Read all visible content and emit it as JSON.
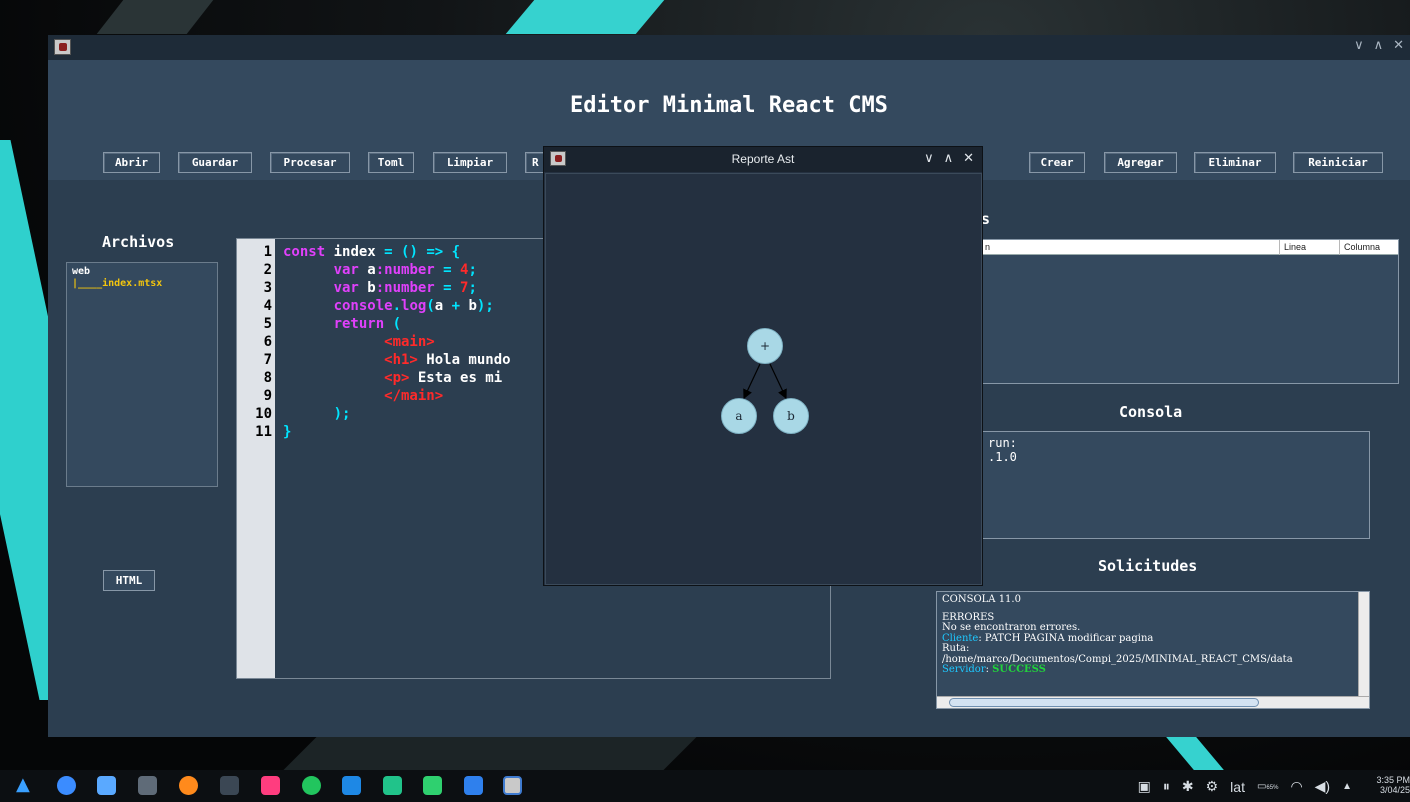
{
  "window": {
    "title": "",
    "controls": [
      "∨",
      "∧",
      "✕"
    ]
  },
  "app": {
    "title": "Editor Minimal React CMS"
  },
  "toolbar": {
    "abrir": "Abrir",
    "guardar": "Guardar",
    "procesar": "Procesar",
    "toml": "Toml",
    "limpiar": "Limpiar",
    "reporte_partial": "R",
    "crear": "Crear",
    "agregar": "Agregar",
    "eliminar": "Eliminar",
    "reiniciar": "Reiniciar"
  },
  "sidebar": {
    "heading": "Archivos",
    "tree_root": "web",
    "tree_file": "|____index.mtsx",
    "html_button": "HTML"
  },
  "editor": {
    "line_numbers": [
      "1",
      "2",
      "3",
      "4",
      "5",
      "6",
      "7",
      "8",
      "9",
      "10",
      "11"
    ],
    "lines": [
      [
        {
          "t": "const",
          "c": "k"
        },
        {
          "t": " index ",
          "c": "w"
        },
        {
          "t": "= () => {",
          "c": "c"
        }
      ],
      [
        {
          "t": "      var ",
          "c": "k"
        },
        {
          "t": "a",
          "c": "w"
        },
        {
          "t": ":number",
          "c": "k"
        },
        {
          "t": " = ",
          "c": "c"
        },
        {
          "t": "4",
          "c": "r"
        },
        {
          "t": ";",
          "c": "c"
        }
      ],
      [
        {
          "t": "      var ",
          "c": "k"
        },
        {
          "t": "b",
          "c": "w"
        },
        {
          "t": ":number",
          "c": "k"
        },
        {
          "t": " = ",
          "c": "c"
        },
        {
          "t": "7",
          "c": "r"
        },
        {
          "t": ";",
          "c": "c"
        }
      ],
      [
        {
          "t": "      console",
          "c": "k"
        },
        {
          "t": ".",
          "c": "c"
        },
        {
          "t": "log",
          "c": "k"
        },
        {
          "t": "(",
          "c": "c"
        },
        {
          "t": "a",
          "c": "w"
        },
        {
          "t": " + ",
          "c": "c"
        },
        {
          "t": "b",
          "c": "w"
        },
        {
          "t": ");",
          "c": "c"
        }
      ],
      [
        {
          "t": "      return ",
          "c": "k"
        },
        {
          "t": "(",
          "c": "c"
        }
      ],
      [
        {
          "t": "            <main>",
          "c": "r"
        }
      ],
      [
        {
          "t": "            <h1>",
          "c": "r"
        },
        {
          "t": " Hola mundo",
          "c": "w"
        }
      ],
      [
        {
          "t": "            <p>",
          "c": "r"
        },
        {
          "t": " Esta es mi",
          "c": "w"
        }
      ],
      [
        {
          "t": "            </main>",
          "c": "r"
        }
      ],
      [
        {
          "t": "      );",
          "c": "c"
        }
      ],
      [
        {
          "t": "}",
          "c": "c"
        }
      ]
    ]
  },
  "errors": {
    "heading_partial": "s",
    "columns": [
      "n",
      "Linea",
      "Columna"
    ]
  },
  "console": {
    "heading": "Consola",
    "lines": [
      "run:",
      ".1.0"
    ]
  },
  "requests": {
    "heading": "Solicitudes",
    "line1": "CONSOLA 11.0",
    "line2": "ERRORES",
    "line3": "No se encontraron errores.",
    "client_label": "Cliente",
    "client_text": ": PATCH PAGINA modificar pagina",
    "route_label": "Ruta:",
    "route_path": "/home/marco/Documentos/Compi_2025/MINIMAL_REACT_CMS/data",
    "server_label": "Servidor",
    "server_status": "SUCCESS"
  },
  "dialog": {
    "title": "Reporte Ast",
    "controls": [
      "∨",
      "∧",
      "✕"
    ],
    "nodes": {
      "root": "+",
      "left": "a",
      "right": "b"
    }
  },
  "taskbar": {
    "tray_keyboard": "lat",
    "battery": "65%",
    "time": "3:35 PM",
    "date": "3/04/25"
  },
  "colors": {
    "app_bg": "#2c3e50",
    "keyword": "#e040fb",
    "operator": "#00e5ff",
    "literal": "#ff2a2a",
    "file_highlight": "#f1c40f",
    "success": "#21d43b",
    "wallpaper_accent": "#36d2cf"
  }
}
